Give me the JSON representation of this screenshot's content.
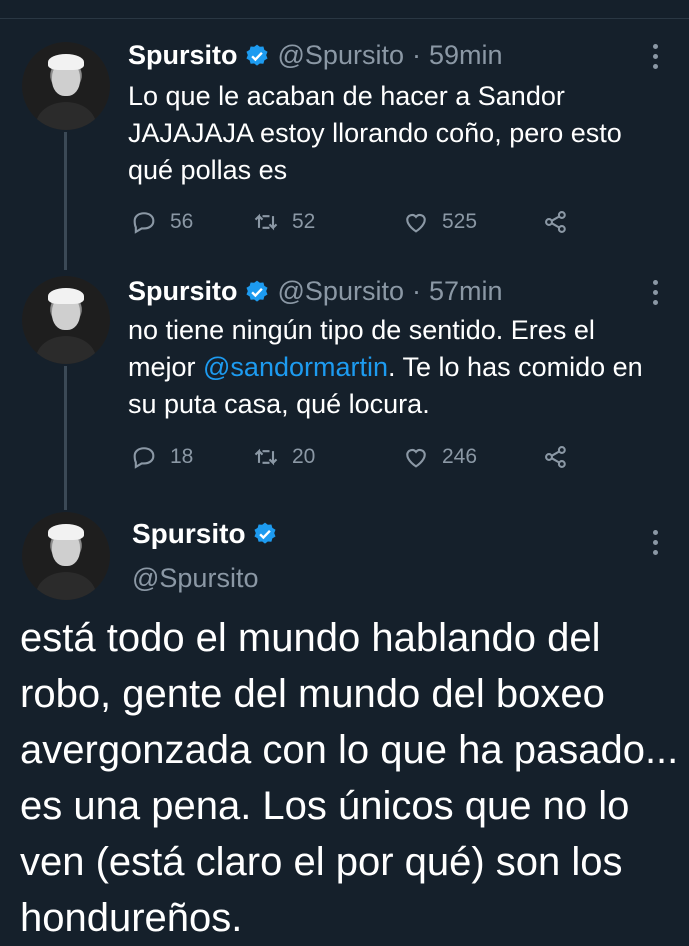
{
  "tweets": [
    {
      "name": "Spursito",
      "handle": "@Spursito",
      "time": "59min",
      "text": "Lo que le acaban de hacer a Sandor JAJAJAJA estoy llorando coño, pero esto qué pollas es",
      "replies": "56",
      "retweets": "52",
      "likes": "525"
    },
    {
      "name": "Spursito",
      "handle": "@Spursito",
      "time": "57min",
      "text_before": "no tiene ningún tipo de sentido. Eres el mejor ",
      "mention": "@sandormartin",
      "text_after": ". Te lo has comido en su puta casa, qué locura.",
      "replies": "18",
      "retweets": "20",
      "likes": "246"
    }
  ],
  "main_tweet": {
    "name": "Spursito",
    "handle": "@Spursito",
    "text": "está todo el mundo hablando del robo, gente del mundo del boxeo avergonzada con lo que ha pasado... es una pena. Los únicos que no lo ven (está claro el por qué) son los hondureños."
  },
  "colors": {
    "background": "#15202b",
    "muted": "#8b98a5",
    "accent": "#1d9bf0",
    "thread_line": "#3b4956"
  },
  "icons": [
    "verified-badge-icon",
    "reply-icon",
    "retweet-icon",
    "like-icon",
    "share-icon",
    "more-icon"
  ]
}
